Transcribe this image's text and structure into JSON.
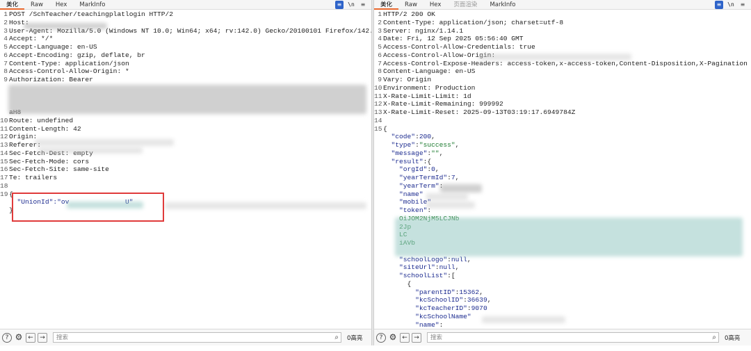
{
  "left": {
    "tabs": [
      "美化",
      "Raw",
      "Hex",
      "MarkInfo"
    ],
    "active_tab": "美化",
    "tools": {
      "wrap": "≡",
      "newline": "\\n",
      "menu": "≡"
    },
    "lines": [
      {
        "n": "1",
        "text": "POST /SchTeacher/teachingplatlogin HTTP/2"
      },
      {
        "n": "2",
        "text": "Host:"
      },
      {
        "n": "3",
        "text": "User-Agent: Mozilla/5.0 (Windows NT 10.0; Win64; x64; rv:142.0) Gecko/20100101 Firefox/142.0"
      },
      {
        "n": "4",
        "text": "Accept: */*"
      },
      {
        "n": "5",
        "text": "Accept-Language: en-US"
      },
      {
        "n": "6",
        "text": "Accept-Encoding: gzip, deflate, br"
      },
      {
        "n": "7",
        "text": "Content-Type: application/json"
      },
      {
        "n": "8",
        "text": "Access-Control-Allow-Origin: *"
      },
      {
        "n": "9",
        "text": "Authorization: Bearer"
      },
      {
        "n": "",
        "text": ""
      },
      {
        "n": "",
        "text": ""
      },
      {
        "n": "",
        "text": ""
      },
      {
        "n": "",
        "text": "aH8"
      },
      {
        "n": "10",
        "text": "Route: undefined"
      },
      {
        "n": "11",
        "text": "Content-Length: 42"
      },
      {
        "n": "12",
        "text": "Origin:"
      },
      {
        "n": "13",
        "text": "Referer:"
      },
      {
        "n": "14",
        "text": "Sec-Fetch-Dest: empty"
      },
      {
        "n": "15",
        "text": "Sec-Fetch-Mode: cors"
      },
      {
        "n": "16",
        "text": "Sec-Fetch-Site: same-site"
      },
      {
        "n": "17",
        "text": "Te: trailers"
      },
      {
        "n": "18",
        "text": ""
      },
      {
        "n": "19",
        "text": "{"
      },
      {
        "n": "",
        "text": "  \"UnionId\":\"ov"
      },
      {
        "n": "",
        "text": "}"
      }
    ],
    "union_tail": "U\"",
    "search_placeholder": "搜索",
    "highlight_count": "0高亮"
  },
  "right": {
    "tabs": [
      "美化",
      "Raw",
      "Hex",
      "页面渲染",
      "MarkInfo"
    ],
    "active_tab": "美化",
    "tools": {
      "wrap": "≡",
      "newline": "\\n",
      "menu": "≡"
    },
    "lines": [
      {
        "n": "1",
        "text": "HTTP/2 200 OK"
      },
      {
        "n": "2",
        "text": "Content-Type: application/json; charset=utf-8"
      },
      {
        "n": "3",
        "text": "Server: nginx/1.14.1"
      },
      {
        "n": "4",
        "text": "Date: Fri, 12 Sep 2025 05:56:40 GMT"
      },
      {
        "n": "5",
        "text": "Access-Control-Allow-Credentials: true"
      },
      {
        "n": "6",
        "text": "Access-Control-Allow-Origin:"
      },
      {
        "n": "7",
        "text": "Access-Control-Expose-Headers: access-token,x-access-token,Content-Disposition,X-Pagination"
      },
      {
        "n": "8",
        "text": "Content-Language: en-US"
      },
      {
        "n": "9",
        "text": "Vary: Origin"
      },
      {
        "n": "10",
        "text": "Environment: Production"
      },
      {
        "n": "11",
        "text": "X-Rate-Limit-Limit: 1d"
      },
      {
        "n": "12",
        "text": "X-Rate-Limit-Remaining: 999992"
      },
      {
        "n": "13",
        "text": "X-Rate-Limit-Reset: 2025-09-13T03:19:17.6949784Z"
      },
      {
        "n": "14",
        "text": ""
      },
      {
        "n": "15",
        "text": "{"
      }
    ],
    "json_lines": [
      {
        "indent": 1,
        "k": "\"code\"",
        "sep": ":",
        "v": "200",
        "vt": "num",
        "tail": ","
      },
      {
        "indent": 1,
        "k": "\"type\"",
        "sep": ":",
        "v": "\"success\"",
        "vt": "str",
        "tail": ","
      },
      {
        "indent": 1,
        "k": "\"message\"",
        "sep": ":",
        "v": "\"\"",
        "vt": "str",
        "tail": ","
      },
      {
        "indent": 1,
        "k": "\"result\"",
        "sep": ":",
        "v": "{",
        "vt": "punc",
        "tail": ""
      },
      {
        "indent": 2,
        "k": "\"orgId\"",
        "sep": ":",
        "v": "0",
        "vt": "num",
        "tail": ","
      },
      {
        "indent": 2,
        "k": "\"yearTermId\"",
        "sep": ":",
        "v": "7",
        "vt": "num",
        "tail": ","
      },
      {
        "indent": 2,
        "k": "\"yearTerm\"",
        "sep": ":",
        "v": "",
        "vt": "str",
        "tail": ""
      },
      {
        "indent": 2,
        "k": "\"name\"",
        "sep": "",
        "v": "",
        "vt": "str",
        "tail": ""
      },
      {
        "indent": 2,
        "k": "\"mobile\"",
        "sep": "",
        "v": "",
        "vt": "str",
        "tail": ""
      },
      {
        "indent": 2,
        "k": "\"token\"",
        "sep": ":",
        "v": "",
        "vt": "str",
        "tail": ""
      },
      {
        "indent": 2,
        "k": "",
        "sep": "",
        "v": "OiJOM2NjM5LCJNb",
        "vt": "str",
        "tail": ""
      },
      {
        "indent": 2,
        "k": "",
        "sep": "",
        "v": "2Jp",
        "vt": "str",
        "tail": ""
      },
      {
        "indent": 2,
        "k": "",
        "sep": "",
        "v": "LC",
        "vt": "str",
        "tail": ""
      },
      {
        "indent": 2,
        "k": "",
        "sep": "",
        "v": "iAVb",
        "vt": "str",
        "tail": ""
      },
      {
        "indent": 2,
        "k": "",
        "sep": "",
        "v": "",
        "vt": "str",
        "tail": ""
      },
      {
        "indent": 2,
        "k": "\"schoolLogo\"",
        "sep": ":",
        "v": "null",
        "vt": "num",
        "tail": ","
      },
      {
        "indent": 2,
        "k": "\"siteUrl\"",
        "sep": ":",
        "v": "null",
        "vt": "num",
        "tail": ","
      },
      {
        "indent": 2,
        "k": "\"schoolList\"",
        "sep": ":",
        "v": "[",
        "vt": "punc",
        "tail": ""
      },
      {
        "indent": 3,
        "k": "",
        "sep": "",
        "v": "{",
        "vt": "punc",
        "tail": ""
      },
      {
        "indent": 4,
        "k": "\"parentID\"",
        "sep": ":",
        "v": "15362",
        "vt": "num",
        "tail": ","
      },
      {
        "indent": 4,
        "k": "\"kcSchoolID\"",
        "sep": ":",
        "v": "36639",
        "vt": "num",
        "tail": ","
      },
      {
        "indent": 4,
        "k": "\"kcTeacherID\"",
        "sep": ":",
        "v": "9070",
        "vt": "num",
        "tail": ""
      },
      {
        "indent": 4,
        "k": "\"kcSchoolName\"",
        "sep": "",
        "v": "",
        "vt": "str",
        "tail": ""
      },
      {
        "indent": 4,
        "k": "\"name\"",
        "sep": ":",
        "v": "",
        "vt": "str",
        "tail": ""
      }
    ],
    "search_placeholder": "搜索",
    "highlight_count": "0高亮"
  },
  "bottom_icons": {
    "help": "?",
    "settings": "⚙",
    "back": "←",
    "forward": "→",
    "search": "⌕"
  },
  "colors": {
    "accent": "#e8672c",
    "highlight_box": "#e03a3a",
    "key": "#1b2a8f",
    "string": "#1b7a2e"
  }
}
